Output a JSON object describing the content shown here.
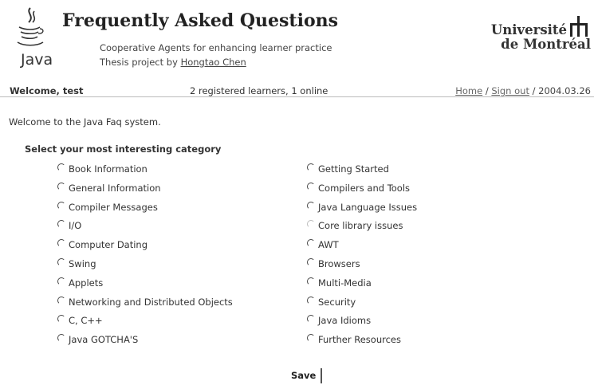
{
  "header": {
    "logo_text": "Java",
    "title": "Frequently Asked Questions",
    "subtitle": "Cooperative Agents for enhancing learner practice",
    "byline_prefix": "Thesis project by",
    "author": "Hongtao Chen",
    "university_line1": "Université",
    "university_line2": "de Montréal"
  },
  "status": {
    "welcome_user": "Welcome, test",
    "learners": "2 registered learners, 1 online",
    "home_link": "Home",
    "sep1": " / ",
    "signout_link": "Sign out",
    "sep2": " / ",
    "date": "2004.03.26"
  },
  "main": {
    "welcome_message": "Welcome to the Java Faq system.",
    "select_heading": "Select your most interesting category",
    "left_categories": [
      "Book Information",
      "General Information",
      "Compiler Messages",
      "I/O",
      "Computer Dating",
      "Swing",
      "Applets",
      "Networking and Distributed Objects",
      "C, C++",
      "Java GOTCHA'S"
    ],
    "right_categories": [
      "Getting Started",
      "Compilers and Tools",
      "Java Language Issues",
      "Core library issues",
      "AWT",
      "Browsers",
      "Multi-Media",
      "Security",
      "Java Idioms",
      "Further Resources"
    ],
    "save_label": "Save"
  }
}
